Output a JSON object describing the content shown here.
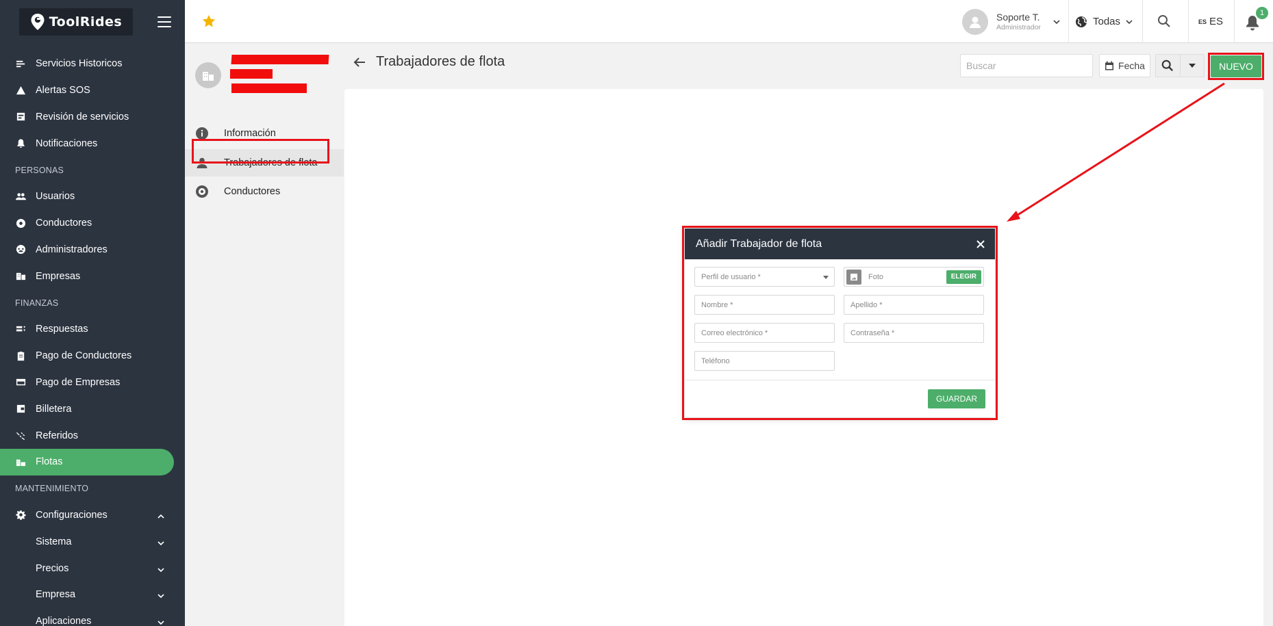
{
  "app": {
    "logo_text": "ToolRides"
  },
  "sidebar": {
    "items": [
      {
        "label": "Servicios Historicos",
        "icon": "list-icon"
      },
      {
        "label": "Alertas SOS",
        "icon": "warning-icon"
      },
      {
        "label": "Revisión de servicios",
        "icon": "review-icon"
      },
      {
        "label": "Notificaciones",
        "icon": "bell-icon"
      }
    ],
    "section_personas": "PERSONAS",
    "personas": [
      {
        "label": "Usuarios",
        "icon": "users-icon"
      },
      {
        "label": "Conductores",
        "icon": "steering-wheel-icon"
      },
      {
        "label": "Administradores",
        "icon": "admin-icon"
      },
      {
        "label": "Empresas",
        "icon": "building-icon"
      }
    ],
    "section_finanzas": "FINANZAS",
    "finanzas": [
      {
        "label": "Respuestas",
        "icon": "answers-icon"
      },
      {
        "label": "Pago de Conductores",
        "icon": "clipboard-icon"
      },
      {
        "label": "Pago de Empresas",
        "icon": "card-icon"
      },
      {
        "label": "Billetera",
        "icon": "wallet-icon"
      },
      {
        "label": "Referidos",
        "icon": "referral-icon"
      },
      {
        "label": "Flotas",
        "icon": "fleet-icon"
      }
    ],
    "section_mantenimiento": "MANTENIMIENTO",
    "mantenimiento": [
      {
        "label": "Configuraciones",
        "icon": "gear-icon"
      },
      {
        "label": "Sistema"
      },
      {
        "label": "Precios"
      },
      {
        "label": "Empresa"
      },
      {
        "label": "Aplicaciones"
      }
    ]
  },
  "topbar": {
    "user_name": "Soporte T.",
    "user_role": "Administrador",
    "zone": "Todas",
    "lang_code": "ES",
    "lang_label": "ES",
    "notifications_count": "1"
  },
  "subnav": {
    "items": [
      {
        "label": "Información"
      },
      {
        "label": "Trabajadores de flota"
      },
      {
        "label": "Conductores"
      }
    ]
  },
  "main": {
    "title": "Trabajadores de flota",
    "search_placeholder": "Buscar",
    "date_label": "Fecha",
    "new_label": "NUEVO"
  },
  "modal": {
    "title": "Añadir Trabajador de flota",
    "perfil_placeholder": "Perfil de usuario *",
    "foto_label": "Foto",
    "elegir_label": "ELEGIR",
    "nombre_placeholder": "Nombre *",
    "apellido_placeholder": "Apellido *",
    "correo_placeholder": "Correo electrónico *",
    "contrasena_placeholder": "Contraseña *",
    "telefono_placeholder": "Teléfono",
    "guardar_label": "GUARDAR"
  },
  "colors": {
    "sidebar_bg": "#2c3440",
    "accent_green": "#4cae6a",
    "highlight_red": "#e8131a"
  }
}
